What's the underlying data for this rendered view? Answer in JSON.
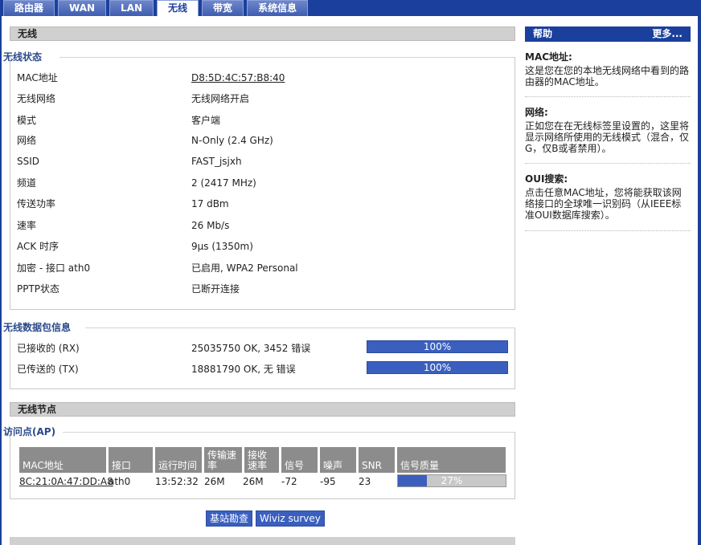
{
  "tabs": [
    {
      "label": "路由器"
    },
    {
      "label": "WAN"
    },
    {
      "label": "LAN"
    },
    {
      "label": "无线"
    },
    {
      "label": "带宽"
    },
    {
      "label": "系统信息"
    }
  ],
  "section_wireless": {
    "title": "无线"
  },
  "status": {
    "legend": "无线状态",
    "rows": [
      {
        "label": "MAC地址",
        "value": "D8:5D:4C:57:B8:40"
      },
      {
        "label": "无线网络",
        "value": "无线网络开启"
      },
      {
        "label": "模式",
        "value": "客户端"
      },
      {
        "label": "网络",
        "value": "N-Only (2.4 GHz)"
      },
      {
        "label": "SSID",
        "value": "FAST_jsjxh"
      },
      {
        "label": "频道",
        "value": "2 (2417 MHz)"
      },
      {
        "label": "传送功率",
        "value": "17 dBm"
      },
      {
        "label": "速率",
        "value": "26 Mb/s"
      },
      {
        "label": "ACK 时序",
        "value": "9µs (1350m)"
      },
      {
        "label": "加密 - 接口 ath0",
        "value": "已启用, WPA2 Personal"
      },
      {
        "label": "PPTP状态",
        "value": "已断开连接"
      }
    ]
  },
  "packets": {
    "legend": "无线数据包信息",
    "rows": [
      {
        "label": "已接收的 (RX)",
        "value": "25035750 OK, 3452 错误",
        "percent_label": "100%",
        "percent": 100
      },
      {
        "label": "已传送的 (TX)",
        "value": "18881790 OK, 无 错误",
        "percent_label": "100%",
        "percent": 100
      }
    ]
  },
  "section_nodes": {
    "title": "无线节点"
  },
  "ap": {
    "legend": "访问点(AP)",
    "headers": {
      "mac": "MAC地址",
      "iface": "接口",
      "uptime": "运行时间",
      "tx": "传输速率",
      "rx": "接收速率",
      "signal": "信号",
      "noise": "噪声",
      "snr": "SNR",
      "quality": "信号质量"
    },
    "row": {
      "mac": "8C:21:0A:47:DD:A8",
      "iface": "ath0",
      "uptime": "13:52:32",
      "tx": "26M",
      "rx": "26M",
      "signal": "-72",
      "noise": "-95",
      "snr": "23",
      "quality_label": "27%",
      "quality": 27
    }
  },
  "buttons": {
    "site_survey": "基站勘查",
    "wiviz": "Wiviz survey"
  },
  "help": {
    "title": "帮助",
    "more": "更多...",
    "items": [
      {
        "title": "MAC地址:",
        "text": "这是您在您的本地无线网络中看到的路由器的MAC地址。"
      },
      {
        "title": "网络:",
        "text": "正如您在在无线标签里设置的，这里将显示网络所使用的无线模式（混合，仅G，仅B或者禁用）。"
      },
      {
        "title": "OUI搜索:",
        "text": "点击任意MAC地址，您将能获取该网络接口的全球唯一识别码（从IEEE标准OUI数据库搜索）。"
      }
    ]
  },
  "colors": {
    "nav": "#1b3f9c",
    "bar": "#3a5fbf",
    "header_gray": "#d0d0d0",
    "table_head": "#8c8c8c"
  }
}
